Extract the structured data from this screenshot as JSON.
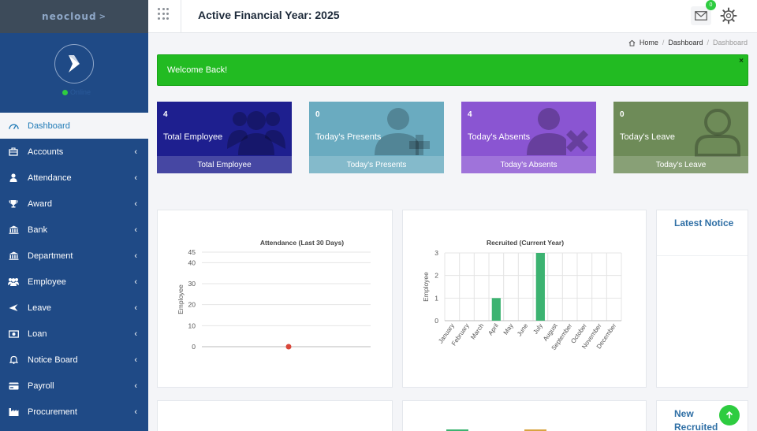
{
  "brand": {
    "logo_text": "neocloud"
  },
  "sidebar": {
    "status": "Online",
    "items": [
      {
        "label": "Dashboard",
        "icon": "dashboard-icon",
        "active": true
      },
      {
        "label": "Accounts",
        "icon": "briefcase-icon"
      },
      {
        "label": "Attendance",
        "icon": "user-icon"
      },
      {
        "label": "Award",
        "icon": "trophy-icon"
      },
      {
        "label": "Bank",
        "icon": "bank-icon"
      },
      {
        "label": "Department",
        "icon": "bank-icon"
      },
      {
        "label": "Employee",
        "icon": "users-icon"
      },
      {
        "label": "Leave",
        "icon": "plane-icon"
      },
      {
        "label": "Loan",
        "icon": "money-icon"
      },
      {
        "label": "Notice Board",
        "icon": "bell-icon"
      },
      {
        "label": "Payroll",
        "icon": "credit-card-icon"
      },
      {
        "label": "Procurement",
        "icon": "industry-icon"
      }
    ]
  },
  "topbar": {
    "title": "Active Financial Year: 2025",
    "mail_badge": "0"
  },
  "breadcrumb": {
    "home": "Home",
    "dashboard": "Dashboard",
    "current": "Dashboard"
  },
  "alert": {
    "message": "Welcome Back!",
    "close": "×"
  },
  "stats": [
    {
      "value": "4",
      "label": "Total Employee",
      "footer": "Total Employee",
      "color": "#1e1f8f",
      "icon": "users-icon"
    },
    {
      "value": "0",
      "label": "Today's Presents",
      "footer": "Today's Presents",
      "color": "#6aabc0",
      "icon": "user-plus-icon"
    },
    {
      "value": "4",
      "label": "Today's Absents",
      "footer": "Today's Absents",
      "color": "#8a55d2",
      "icon": "user-times-icon"
    },
    {
      "value": "0",
      "label": "Today's Leave",
      "footer": "Today's Leave",
      "color": "#6e8b58",
      "icon": "user-outline-icon"
    }
  ],
  "panels": {
    "latest_notice": "Latest Notice",
    "new_recruited": "New Recruited"
  },
  "chart_data": [
    {
      "type": "line",
      "title": "Attendance (Last 30 Days)",
      "xlabel": "",
      "ylabel": "Employee",
      "yticks": [
        0,
        10,
        20,
        30,
        40,
        45
      ],
      "ylim": [
        0,
        45
      ],
      "series": [
        {
          "values": [
            0
          ],
          "color": "#d9473a"
        }
      ],
      "grid": true
    },
    {
      "type": "bar",
      "title": "Recruited (Current Year)",
      "xlabel": "",
      "ylabel": "Employee",
      "categories": [
        "January",
        "February",
        "March",
        "April",
        "May",
        "June",
        "July",
        "August",
        "September",
        "October",
        "November",
        "December"
      ],
      "values": [
        0,
        0,
        0,
        1,
        0,
        0,
        3,
        0,
        0,
        0,
        0,
        0
      ],
      "yticks": [
        0,
        1,
        2,
        3
      ],
      "ylim": [
        0,
        3
      ],
      "color": "#3cb371",
      "grid": true
    }
  ]
}
